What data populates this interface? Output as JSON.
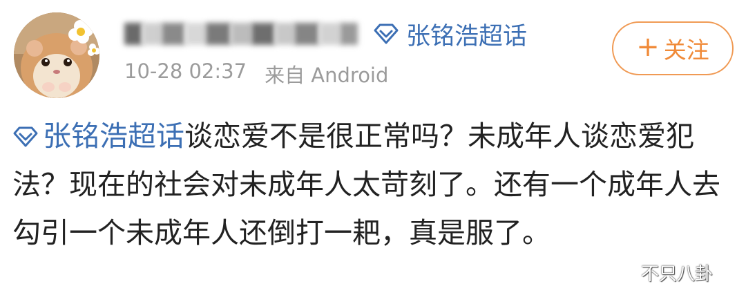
{
  "post": {
    "username_blurred": "blurred-username",
    "supertopic": {
      "label": "张铭浩超话",
      "icon": "supertopic-diamond-icon",
      "color": "#3c6fb4"
    },
    "meta": {
      "time": "10-28 02:37",
      "source": "来自 Android"
    },
    "follow_button": {
      "label": "关注",
      "icon": "plus-icon",
      "plus": "+",
      "color": "#f08a38"
    },
    "content": {
      "topic_label": "张铭浩超话",
      "text": "谈恋爱不是很正常吗？未成年人谈恋爱犯法？现在的社会对未成年人太苛刻了。还有一个成年人去勾引一个未成年人还倒打一耙，真是服了。"
    },
    "watermark": {
      "label": "不只八卦",
      "icon": "wechat-icon"
    }
  }
}
